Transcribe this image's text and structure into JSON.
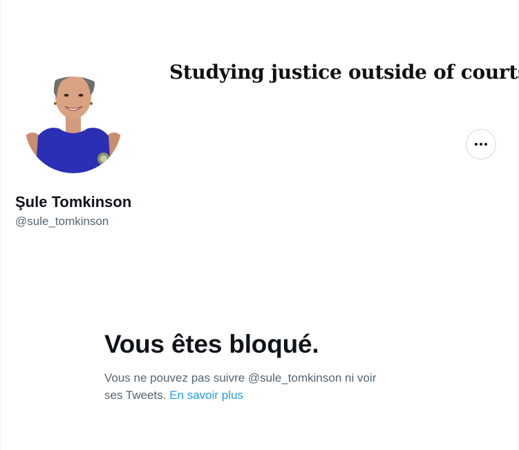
{
  "banner": {
    "text": "Studying justice outside of courts"
  },
  "profile": {
    "display_name": "Şule Tomkinson",
    "handle": "@sule_tomkinson",
    "more_icon": "more-horizontal-icon"
  },
  "blocked": {
    "title": "Vous êtes bloqué.",
    "message_line1": "Vous ne pouvez pas suivre @sule_tomkinson ni voir",
    "message_line2": "ses Tweets.",
    "learn_more": "En savoir plus"
  },
  "colors": {
    "primary_text": "#0f1419",
    "secondary_text": "#536471",
    "link": "#1d9bf0",
    "dress": "#2b2fb4",
    "border": "#cfd9de"
  }
}
